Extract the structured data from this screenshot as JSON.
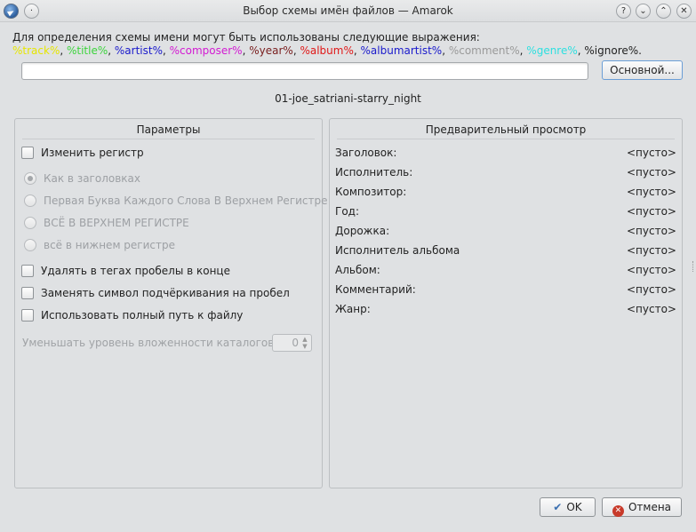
{
  "window": {
    "title": "Выбор схемы имён файлов — Amarok",
    "buttons": [
      "?",
      "⌄",
      "⌃",
      "✕"
    ],
    "menu_button": "·"
  },
  "intro": "Для определения схемы имени могут быть использованы следующие выражения:",
  "tokens": [
    {
      "text": "%track%",
      "color": "#e6e600"
    },
    {
      "text": "%title%",
      "color": "#3cd43c"
    },
    {
      "text": "%artist%",
      "color": "#1a1acc"
    },
    {
      "text": "%composer%",
      "color": "#d31ad3"
    },
    {
      "text": "%year%",
      "color": "#7a2020"
    },
    {
      "text": "%album%",
      "color": "#e01818"
    },
    {
      "text": "%albumartist%",
      "color": "#1a1acc"
    },
    {
      "text": "%comment%",
      "color": "#9a9a9a"
    },
    {
      "text": "%genre%",
      "color": "#2ee0e0"
    },
    {
      "text": "%ignore%",
      "color": "#222222"
    }
  ],
  "scheme_input": {
    "value": ""
  },
  "basic_button": "Основной...",
  "filename": "01-joe_satriani-starry_night",
  "options": {
    "title": "Параметры",
    "change_case": "Изменить регистр",
    "case_options": [
      "Как в заголовках",
      "Первая Буква Каждого Слова В Верхнем Регистре",
      "ВСЁ В ВЕРХНЕМ РЕГИСТРЕ",
      "всё в нижнем регистре"
    ],
    "strip_spaces": "Удалять в тегах пробелы в конце",
    "replace_underscore": "Заменять символ подчёркивания на пробел",
    "use_full_path": "Использовать полный путь к файлу",
    "depth_label": "Уменьшать уровень вложенности каталогов до:",
    "depth_value": "0"
  },
  "preview": {
    "title": "Предварительный просмотр",
    "rows": [
      {
        "label": "Заголовок:",
        "value": "<пусто>"
      },
      {
        "label": "Исполнитель:",
        "value": "<пусто>"
      },
      {
        "label": "Композитор:",
        "value": "<пусто>"
      },
      {
        "label": "Год:",
        "value": "<пусто>"
      },
      {
        "label": "Дорожка:",
        "value": "<пусто>"
      },
      {
        "label": "Исполнитель альбома",
        "value": "<пусто>"
      },
      {
        "label": "Альбом:",
        "value": "<пусто>"
      },
      {
        "label": "Комментарий:",
        "value": "<пусто>"
      },
      {
        "label": "Жанр:",
        "value": "<пусто>"
      }
    ]
  },
  "ok_button": "OK",
  "cancel_button": "Отмена"
}
